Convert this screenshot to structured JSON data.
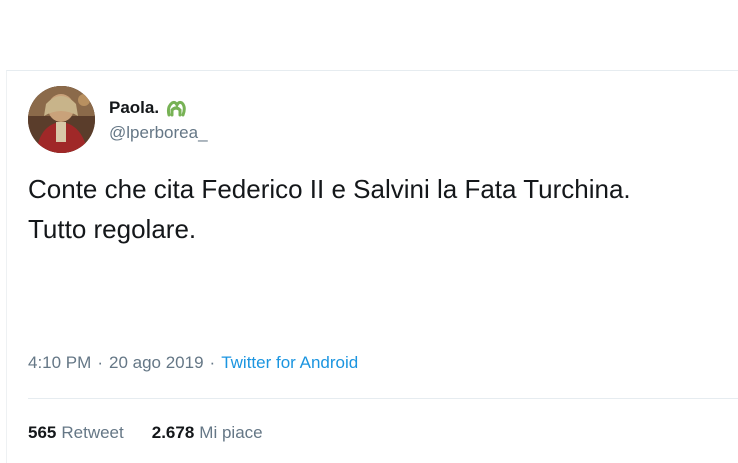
{
  "user": {
    "display_name": "Paola.",
    "handle": "@lperborea_",
    "emoji_icon": "green-clover-emoji-icon",
    "avatar": "avatar-photo"
  },
  "tweet": {
    "text": "Conte che cita Federico II e Salvini la Fata Turchina.\nTutto regolare."
  },
  "meta": {
    "time": "4:10 PM",
    "separator1": "·",
    "date": "20 ago 2019",
    "separator2": "·",
    "source": "Twitter for Android"
  },
  "stats": {
    "retweets_count": "565",
    "retweets_label": "Retweet",
    "likes_count": "2.678",
    "likes_label": "Mi piace"
  },
  "colors": {
    "text_primary": "#14171a",
    "text_secondary": "#657786",
    "link": "#1b95e0",
    "divider": "#e6ecf0",
    "emoji_green": "#77b255"
  }
}
